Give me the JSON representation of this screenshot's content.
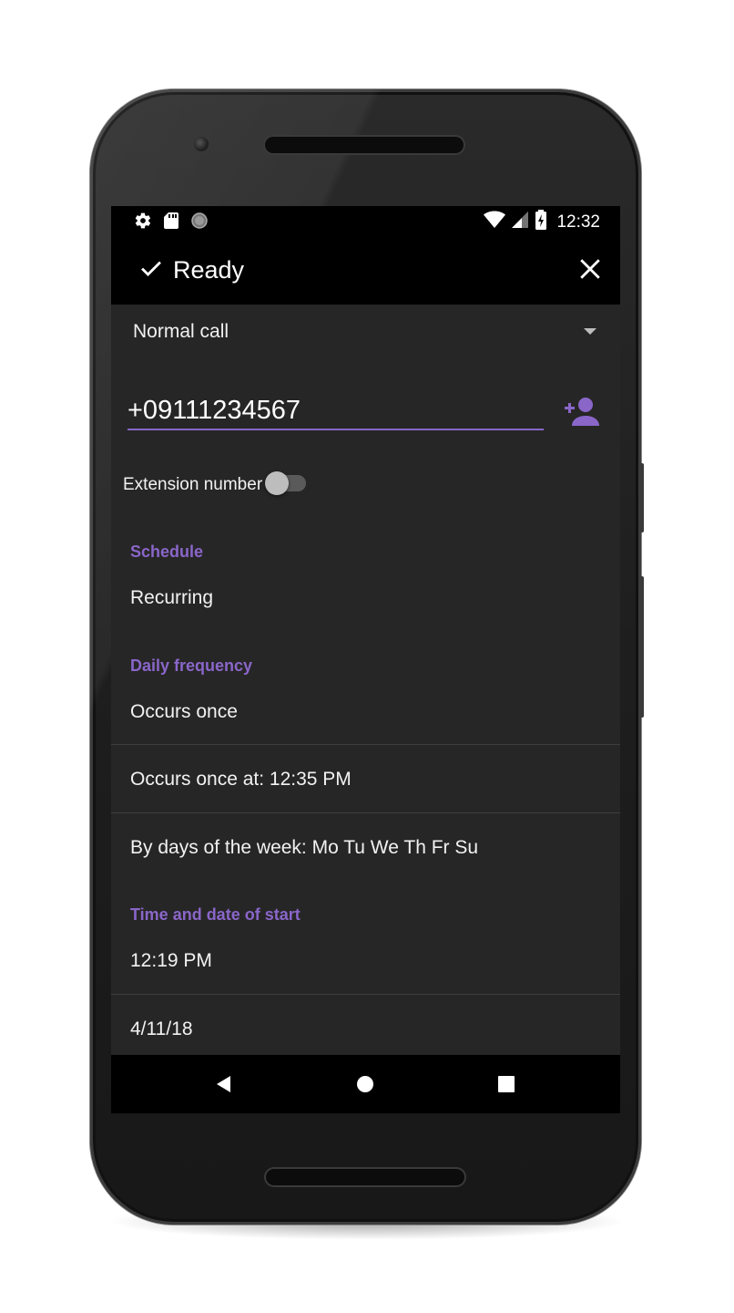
{
  "status_bar": {
    "time": "12:32",
    "left_icons": [
      "gear-icon",
      "sd-card-icon",
      "circle-icon"
    ],
    "right_icons": [
      "wifi-icon",
      "signal-icon",
      "battery-charging-icon"
    ]
  },
  "app_bar": {
    "ready_label": "Ready",
    "ready_icon": "checkmark-icon",
    "close_icon": "close-icon"
  },
  "form": {
    "call_type": "Normal call",
    "phone_number": "+09111234567",
    "add_contact_icon": "add-contact-icon",
    "extension_label": "Extension number",
    "extension_enabled": false,
    "schedule_label": "Schedule",
    "schedule_value": "Recurring",
    "daily_frequency_label": "Daily frequency",
    "daily_frequency_value": "Occurs once",
    "occurs_once_at": "Occurs once at: 12:35 PM",
    "days_of_week": "By days of the week: Mo Tu We Th Fr Su",
    "start_label": "Time and date of start",
    "start_time": "12:19 PM",
    "start_date": "4/11/18"
  },
  "nav_bar": {
    "icons": [
      "back-icon",
      "home-icon",
      "recents-icon"
    ]
  },
  "colors": {
    "accent": "#8a66c9",
    "background": "#262626",
    "bars": "#000000"
  }
}
